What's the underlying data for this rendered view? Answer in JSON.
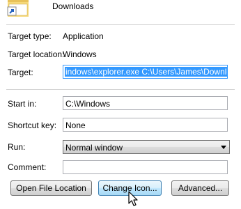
{
  "header": {
    "title": "Downloads",
    "icon": "folder-shortcut-icon"
  },
  "info": {
    "target_type_label": "Target type:",
    "target_type_value": "Application",
    "target_location_label": "Target location:",
    "target_location_value": "Windows",
    "target_label": "Target:",
    "target_value": "indows\\explorer.exe C:\\Users\\James\\Downloads"
  },
  "fields": {
    "start_in_label": "Start in:",
    "start_in_value": "C:\\Windows",
    "shortcut_key_label": "Shortcut key:",
    "shortcut_key_value": "None",
    "run_label": "Run:",
    "run_value": "Normal window",
    "comment_label": "Comment:",
    "comment_value": ""
  },
  "buttons": {
    "open_file_location": "Open File Location",
    "change_icon": "Change Icon...",
    "advanced": "Advanced..."
  },
  "colors": {
    "selection": "#3399ff",
    "focus_border": "#3399ff",
    "hover_border": "#3c7fb1"
  }
}
